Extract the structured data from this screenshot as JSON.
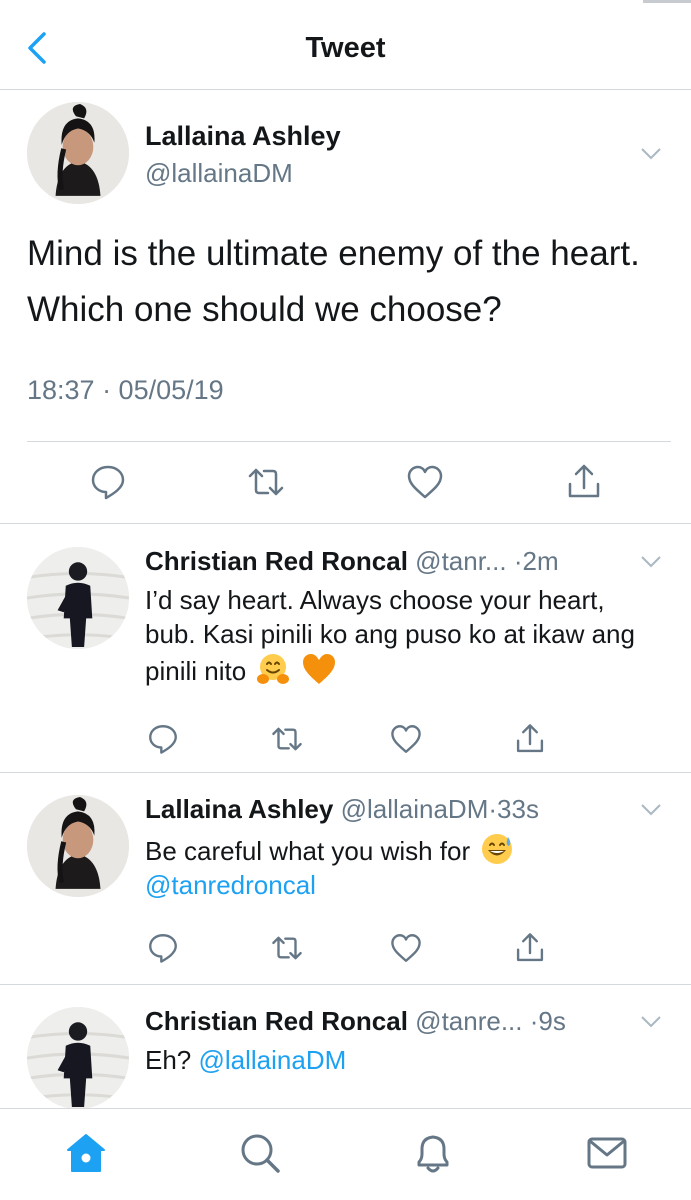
{
  "header": {
    "title": "Tweet"
  },
  "main_tweet": {
    "name": "Lallaina Ashley",
    "handle": "@lallainaDM",
    "text": "Mind is the ultimate enemy of the heart. Which one should we choose?",
    "timestamp": "18:37 · 05/05/19"
  },
  "replies": [
    {
      "name": "Christian Red Roncal",
      "handle": "@tanr...",
      "time": "·2m",
      "text": "I’d say heart. Always choose your heart, bub. Kasi pinili ko ang puso ko at ikaw ang pinili nito",
      "emojis": [
        "hugging-face-emoji",
        "orange-heart-emoji"
      ]
    },
    {
      "name": "Lallaina Ashley",
      "handle": "@lallainaDM",
      "time": "·33s",
      "text": "Be careful what you wish for",
      "emojis": [
        "grinning-sweat-emoji"
      ],
      "mention": "@tanredroncal"
    },
    {
      "name": "Christian Red Roncal",
      "handle": "@tanre...",
      "time": "·9s",
      "text": "Eh?",
      "mention": "@lallainaDM"
    }
  ],
  "icons": {
    "action_bar": [
      "reply-icon",
      "retweet-icon",
      "like-icon",
      "share-icon"
    ],
    "tab_bar": [
      "home-icon",
      "search-icon",
      "notifications-icon",
      "messages-icon"
    ]
  },
  "colors": {
    "accent": "#1da1f2",
    "text": "#14171a",
    "secondary": "#657786",
    "divider": "#d5d9dc"
  }
}
